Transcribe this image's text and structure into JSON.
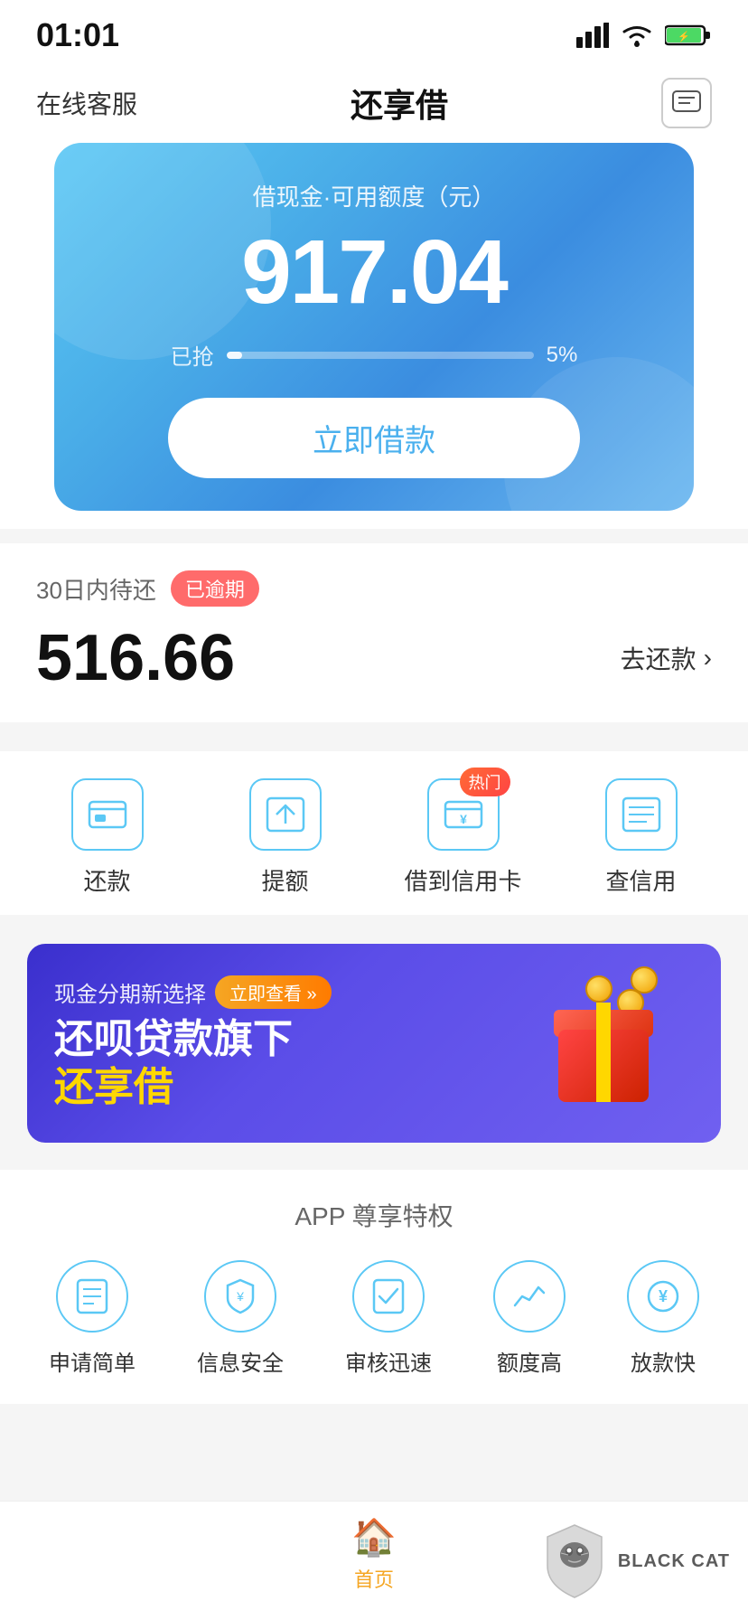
{
  "statusBar": {
    "time": "01:01"
  },
  "nav": {
    "leftLabel": "在线客服",
    "title": "还享借",
    "rightIcon": "message-icon"
  },
  "heroCard": {
    "subtitle": "借现金·可用额度（元）",
    "amount": "917.04",
    "progressLabel": "已抢",
    "progressPct": "5%",
    "btnLabel": "立即借款"
  },
  "repayCard": {
    "label": "30日内待还",
    "badge": "已逾期",
    "amount": "516.66",
    "actionLabel": "去还款"
  },
  "quickActions": [
    {
      "label": "还款",
      "icon": "repay-icon",
      "hot": false
    },
    {
      "label": "提额",
      "icon": "upgrade-icon",
      "hot": false
    },
    {
      "label": "借到信用卡",
      "icon": "creditcard-icon",
      "hot": true
    },
    {
      "label": "查信用",
      "icon": "credit-check-icon",
      "hot": false
    }
  ],
  "banner": {
    "topText": "现金分期新选择",
    "checkBtn": "立即查看 »",
    "mainLine1": "还呗贷款旗下",
    "mainLine2": "还享借"
  },
  "featuresSection": {
    "title": "APP 尊享特权",
    "features": [
      {
        "label": "申请简单",
        "icon": "📋"
      },
      {
        "label": "信息安全",
        "icon": "🛡"
      },
      {
        "label": "审核迅速",
        "icon": "✅"
      },
      {
        "label": "额度高",
        "icon": "📈"
      },
      {
        "label": "放款快",
        "icon": "💴"
      }
    ]
  },
  "bottomNav": {
    "items": [
      {
        "label": "首页",
        "icon": "🏠",
        "active": true
      }
    ]
  },
  "watermark": {
    "text": "BLACK CAT"
  }
}
